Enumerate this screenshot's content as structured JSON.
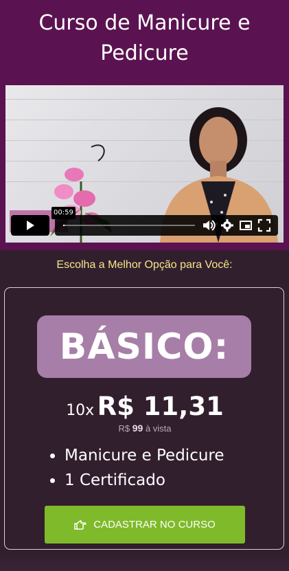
{
  "header": {
    "title_line1": "Curso de Manicure e",
    "title_line2": "Pedicure"
  },
  "video": {
    "current_time": "00:59",
    "progress_fraction": 0.01,
    "icons": [
      "play-icon",
      "volume-icon",
      "settings-icon",
      "picture-in-picture-icon",
      "fullscreen-icon"
    ]
  },
  "offer": {
    "subtitle": "Escolha a Melhor Opção para Você:",
    "plan_name": "BÁSICO:",
    "installments_prefix": "10x",
    "installment_price": "R$ 11,31",
    "cash_prefix": "R$",
    "cash_value": "99",
    "cash_suffix": "à vista",
    "features": [
      "Manicure e Pedicure",
      "1 Certificado"
    ],
    "cta_label": "CADASTRAR NO CURSO"
  },
  "colors": {
    "header_bg": "#5a1350",
    "page_bg": "#321f2e",
    "badge_bg": "#a77ea8",
    "cta_bg": "#7fba2a",
    "subtitle_text": "#f4e88a"
  }
}
